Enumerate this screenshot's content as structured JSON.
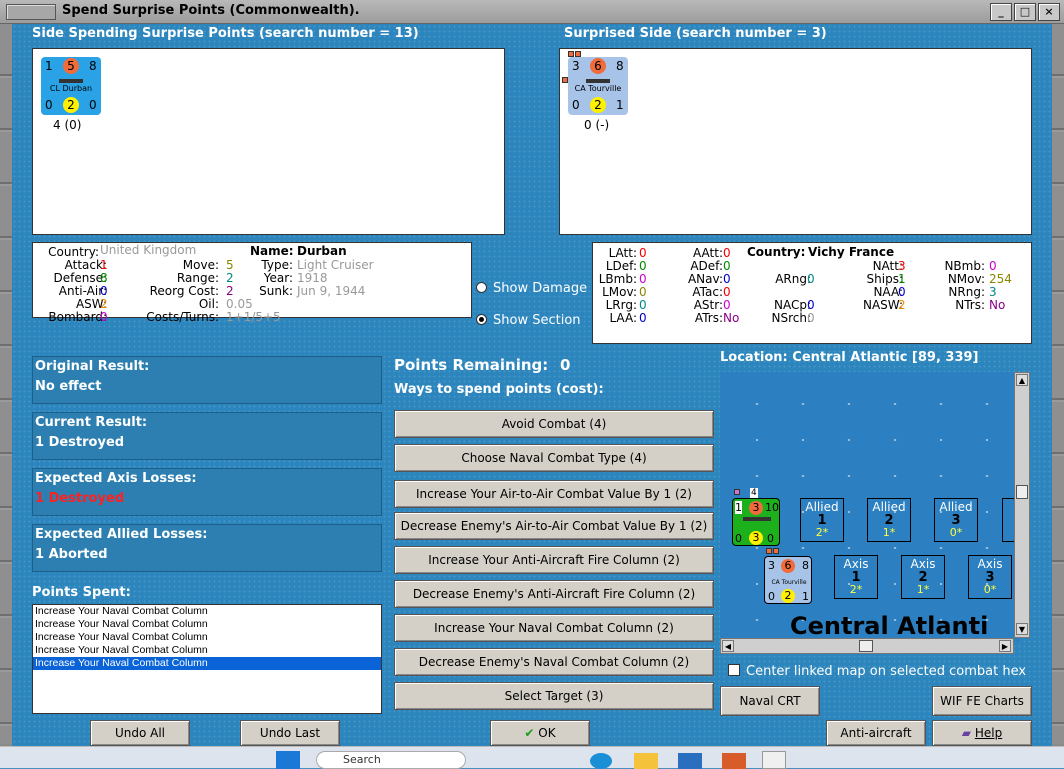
{
  "window": {
    "title": "Spend Surprise Points (Commonwealth)."
  },
  "left": {
    "header": "Side Spending Surprise Points (search number = 13)",
    "counter": {
      "tl": "1",
      "tc": "5",
      "tr": "8",
      "name": "CL Durban",
      "bl": "0",
      "bc": "2",
      "br": "0",
      "below": "4 (0)"
    },
    "stats": {
      "country_label": "Country:",
      "country": "United Kingdom",
      "attack_label": "Attack:",
      "attack": "1",
      "defense_label": "Defense:",
      "defense": "8",
      "aa_label": "Anti-Air:",
      "aa": "0",
      "asw_label": "ASW:",
      "asw": "2",
      "bombard_label": "Bombard:",
      "bombard": "0",
      "move_label": "Move:",
      "move": "5",
      "range_label": "Range:",
      "range": "2",
      "reorg_label": "Reorg Cost:",
      "reorg": "2",
      "oil_label": "Oil:",
      "oil": "0.05",
      "costs_label": "Costs/Turns:",
      "costs": "1+1/5+5",
      "name_label": "Name:",
      "name": "Durban",
      "type_label": "Type:",
      "type": "Light Cruiser",
      "year_label": "Year:",
      "year": "1918",
      "sunk_label": "Sunk:",
      "sunk": "Jun 9, 1944"
    }
  },
  "right": {
    "header": "Surprised Side (search number = 3)",
    "counter": {
      "tl": "3",
      "tc": "6",
      "tr": "8",
      "name": "CA Tourville",
      "bl": "0",
      "bc": "2",
      "br": "1",
      "below": "0 (-)"
    },
    "stats": {
      "latt_l": "LAtt:",
      "latt": "0",
      "ldef_l": "LDef:",
      "ldef": "0",
      "lbmb_l": "LBmb:",
      "lbmb": "0",
      "lmov_l": "LMov:",
      "lmov": "0",
      "lrrg_l": "LRrg:",
      "lrrg": "0",
      "laa_l": "LAA:",
      "laa": "0",
      "aatt_l": "AAtt:",
      "aatt": "0",
      "adef_l": "ADef:",
      "adef": "0",
      "anav_l": "ANav:",
      "anav": "0",
      "atac_l": "ATac:",
      "atac": "0",
      "astr_l": "AStr:",
      "astr": "0",
      "atrs_l": "ATrs:",
      "atrs": "No",
      "country_label": "Country:",
      "country": "Vichy France",
      "arng_l": "ARng:",
      "arng": "0",
      "nacp_l": "NACp:",
      "nacp": "0",
      "nsrch_l": "NSrch:",
      "nsrch": "0",
      "natt_l": "NAtt:",
      "natt": "3",
      "ships_l": "Ships:",
      "ships": "1",
      "naa_l": "NAA:",
      "naa": "0",
      "nasw_l": "NASW:",
      "nasw": "2",
      "nbmb_l": "NBmb:",
      "nbmb": "0",
      "nmov_l": "NMov:",
      "nmov": "254",
      "nrng_l": "NRng:",
      "nrng": "3",
      "ntrs_l": "NTrs:",
      "ntrs": "No"
    }
  },
  "radios": {
    "show_damage": "Show Damage",
    "show_section": "Show Section"
  },
  "results": {
    "original_label": "Original Result:",
    "original": "No effect",
    "current_label": "Current Result:",
    "current": "1 Destroyed",
    "axis_label": "Expected Axis Losses:",
    "axis": "1 Destroyed",
    "allied_label": "Expected Allied Losses:",
    "allied": "1 Aborted"
  },
  "points": {
    "spent_label": "Points Spent:",
    "spent": [
      "Increase Your Naval Combat Column",
      "Increase Your Naval Combat Column",
      "Increase Your Naval Combat Column",
      "Increase Your Naval Combat Column",
      "Increase Your Naval Combat Column"
    ],
    "remaining_label": "Points Remaining:",
    "remaining": "0",
    "ways_label": "Ways to spend points (cost):"
  },
  "spend_buttons": [
    "Avoid Combat (4)",
    "Choose Naval Combat Type (4)",
    "Increase Your Air-to-Air Combat Value By 1 (2)",
    "Decrease Enemy's Air-to-Air Combat Value By 1 (2)",
    "Increase Your Anti-Aircraft Fire Column (2)",
    "Decrease Enemy's Anti-Aircraft Fire Column (2)",
    "Increase Your Naval Combat Column (2)",
    "Decrease Enemy's Naval Combat Column (2)",
    "Select Target (3)"
  ],
  "location": "Location: Central Atlantic [89, 339]",
  "map": {
    "label": "Central Atlanti",
    "stack_count": "4",
    "green_counter": {
      "tl": "1",
      "tc": "3",
      "tr": "10",
      "bl": "0",
      "bc": "3",
      "br": "0"
    },
    "counter": {
      "tl": "3",
      "tc": "6",
      "tr": "8",
      "name": "CA Tourville",
      "bl": "0",
      "bc": "2",
      "br": "1"
    },
    "allied": [
      {
        "t": "Allied",
        "n": "1",
        "s": "2*"
      },
      {
        "t": "Allied",
        "n": "2",
        "s": "1*"
      },
      {
        "t": "Allied",
        "n": "3",
        "s": "0*"
      }
    ],
    "axis": [
      {
        "t": "Axis",
        "n": "1",
        "s": "2*"
      },
      {
        "t": "Axis",
        "n": "2",
        "s": "1*"
      },
      {
        "t": "Axis",
        "n": "3",
        "s": "0*"
      }
    ]
  },
  "center_linked": "Center linked map on selected combat hex",
  "buttons": {
    "undo_all": "Undo All",
    "undo_last": "Undo Last",
    "ok": "OK",
    "naval_crt": "Naval CRT",
    "wif_charts": "WIF FE Charts",
    "aa_crt": "Anti-aircraft CRT",
    "help": "Help"
  },
  "taskbar": {
    "search": "Search"
  },
  "colors": {
    "blue_counter": "#2aa3e6",
    "vichy_counter": "#a7c4e8",
    "green_counter": "#1db01d",
    "orange_circle": "#f26b3a",
    "yellow_circle": "#ffef00",
    "panel": "#2c86bd"
  }
}
